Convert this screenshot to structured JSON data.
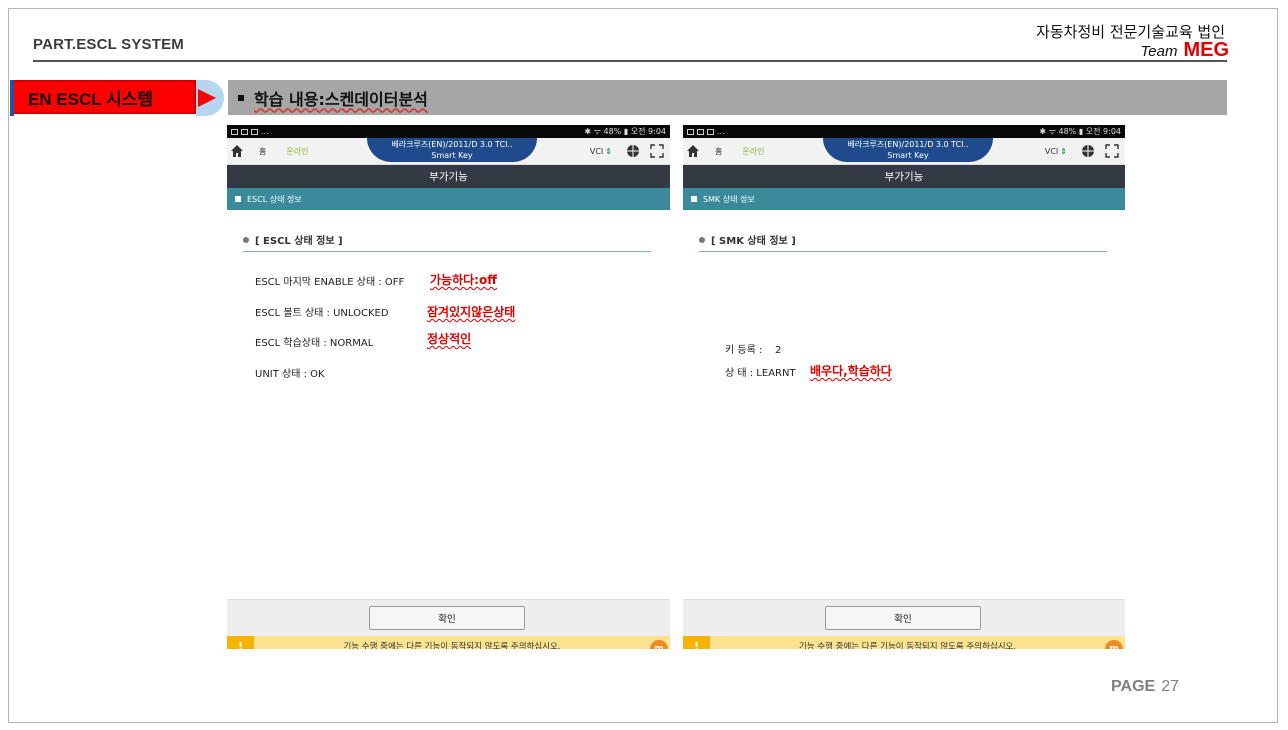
{
  "header": {
    "part_title": "PART.ESCL SYSTEM",
    "org_name": "자동차정비 전문기술교육 법인",
    "team_prefix": "Team",
    "team_name": "MEG"
  },
  "section_tag": "EN ESCL 시스템",
  "topic": "학습 내용:스켄데이터분석",
  "colors": {
    "accent_red": "#ff0000",
    "teal": "#3a8a9c",
    "navy": "#1f4a8c",
    "warn": "#fde38f"
  },
  "phones": [
    {
      "status_left": "...",
      "status_right": "✱ ᯤ 48% ▮ 오전 9:04",
      "home": "홈",
      "online": "온라인",
      "vehicle_line1": "베라크루즈(EN)/2011/D 3.0 TCI..",
      "vehicle_line2": "Smart Key",
      "vci": "VCI",
      "title": "부가기능",
      "section": "ESCL 상태 정보",
      "info_head": "[ ESCL 상태 정보 ]",
      "rows": [
        "ESCL 마지막 ENABLE 상태 : OFF",
        "ESCL 볼트 상태 : UNLOCKED",
        "ESCL 학습상태 : NORMAL",
        "UNIT 상태 : OK"
      ],
      "notes": [
        "가능하다:off",
        "잠겨있지않은상태",
        "정상적인"
      ],
      "confirm": "확인",
      "warning": "기능 수행 중에는 다른 기능이 동작되지 않도록 주의하십시오."
    },
    {
      "status_left": "...",
      "status_right": "✱ ᯤ 48% ▮ 오전 9:04",
      "home": "홈",
      "online": "온라인",
      "vehicle_line1": "베라크루즈(EN)/2011/D 3.0 TCI..",
      "vehicle_line2": "Smart Key",
      "vci": "VCI",
      "title": "부가기능",
      "section": "SMK 상태 정보",
      "info_head": "[ SMK 상태 정보 ]",
      "rows": [
        "키 등록 :    2",
        "상 태 : LEARNT"
      ],
      "notes": [
        "배우다,학습하다"
      ],
      "confirm": "확인",
      "warning": "기능 수행 중에는 다른 기능이 동작되지 않도록 주의하십시오."
    }
  ],
  "page": {
    "label": "PAGE",
    "number": "27"
  }
}
